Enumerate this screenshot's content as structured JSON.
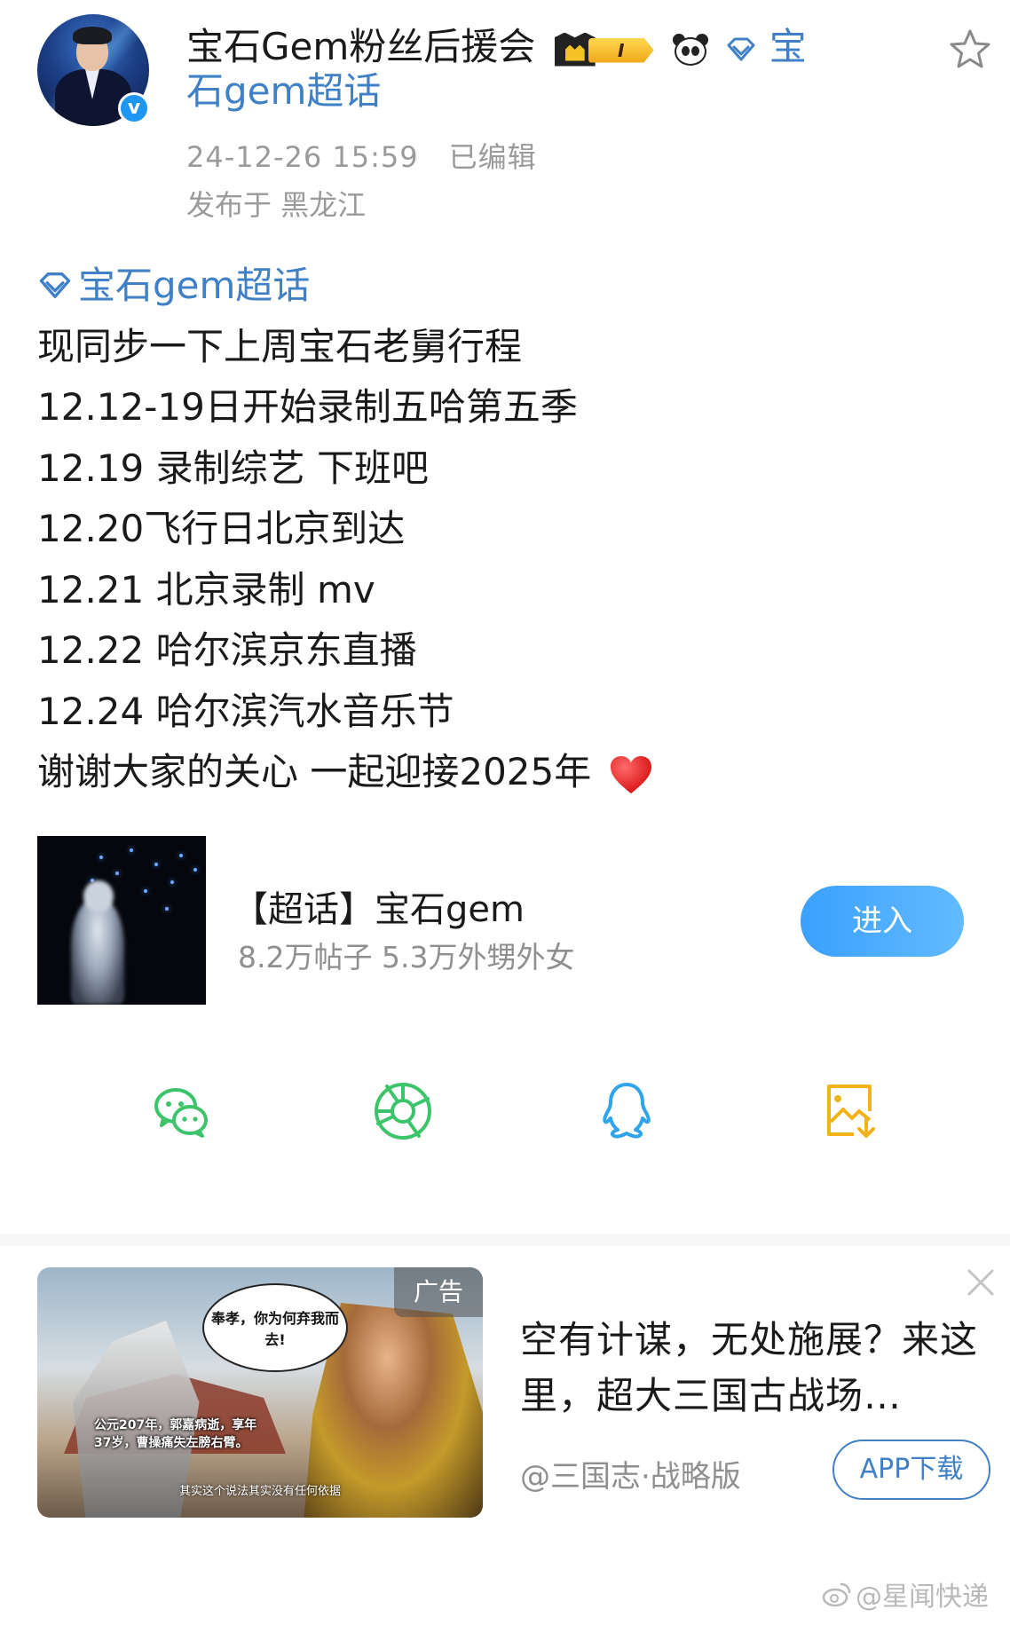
{
  "post": {
    "author": {
      "name": "宝石Gem粉丝后援会",
      "fan_level": "I",
      "topic_link": "宝石gem超话",
      "topic_link_line1": "宝",
      "topic_link_line2": "石gem超话"
    },
    "meta": {
      "timestamp": "24-12-26 15:59",
      "edited": "已编辑",
      "location": "发布于 黑龙江"
    },
    "tag": "宝石gem超话",
    "lines": [
      "现同步一下上周宝石老舅行程",
      "12.12-19日开始录制五哈第五季",
      "12.19 录制综艺 下班吧",
      "12.20飞行日北京到达",
      "12.21 北京录制 mv",
      "12.22 哈尔滨京东直播",
      "12.24 哈尔滨汽水音乐节",
      "谢谢大家的关心  一起迎接2025年"
    ],
    "heart_icon": "red-heart-emoji"
  },
  "topic_card": {
    "title": "【超话】宝石gem",
    "stats": "8.2万帖子 5.3万外甥外女",
    "enter_label": "进入"
  },
  "share": {
    "icons": [
      "wechat-icon",
      "moments-icon",
      "qq-icon",
      "save-image-icon"
    ],
    "colors": {
      "wechat": "#3cc46a",
      "moments": "#3cc46a",
      "qq": "#2fa4ea",
      "save": "#f2b21a"
    }
  },
  "ad": {
    "badge": "广告",
    "image_bubble": "奉孝，你为何弃我而去!",
    "image_caption": "公元207年，郭嘉病逝，享年37岁，曹操痛失左膀右臂。",
    "image_footnote": "其实这个说法其实没有任何依据",
    "title": "空有计谋，无处施展？来这里，超大三国古战场…",
    "source": "@三国志·战略版",
    "download_label": "APP下载"
  },
  "watermark": "@星闻快递",
  "colors": {
    "link": "#3f80c6",
    "accent_button": "#3aa0ff",
    "meta_gray": "#9a9a9a"
  }
}
